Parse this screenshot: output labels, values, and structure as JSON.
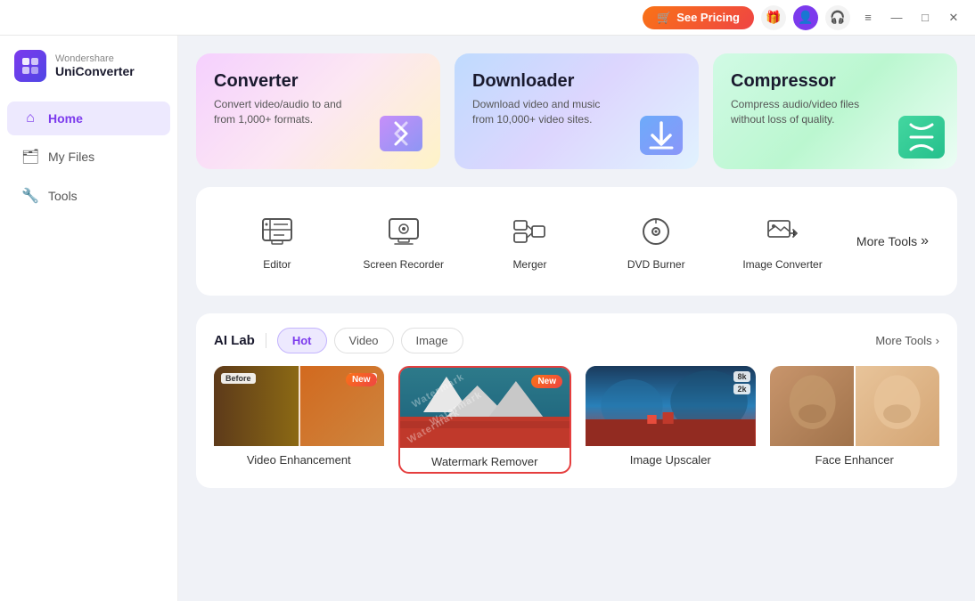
{
  "titlebar": {
    "see_pricing": "See Pricing",
    "cart_icon": "🛒",
    "gift_icon": "🎁",
    "user_icon": "👤",
    "headset_icon": "🎧",
    "menu_icon": "≡",
    "minimize": "—",
    "maximize": "□",
    "close": "✕"
  },
  "logo": {
    "brand": "Wondershare",
    "product": "UniConverter"
  },
  "sidebar": {
    "items": [
      {
        "id": "home",
        "label": "Home",
        "icon": "⌂",
        "active": true
      },
      {
        "id": "my-files",
        "label": "My Files",
        "icon": "🗂",
        "active": false
      },
      {
        "id": "tools",
        "label": "Tools",
        "icon": "🔧",
        "active": false
      }
    ]
  },
  "hero_cards": [
    {
      "id": "converter",
      "title": "Converter",
      "desc": "Convert video/audio to and from 1,000+ formats.",
      "type": "converter"
    },
    {
      "id": "downloader",
      "title": "Downloader",
      "desc": "Download video and music from 10,000+ video sites.",
      "type": "downloader"
    },
    {
      "id": "compressor",
      "title": "Compressor",
      "desc": "Compress audio/video files without loss of quality.",
      "type": "compressor"
    }
  ],
  "tools": {
    "items": [
      {
        "id": "editor",
        "label": "Editor"
      },
      {
        "id": "screen-recorder",
        "label": "Screen Recorder"
      },
      {
        "id": "merger",
        "label": "Merger"
      },
      {
        "id": "dvd-burner",
        "label": "DVD Burner"
      },
      {
        "id": "image-converter",
        "label": "Image Converter"
      }
    ],
    "more_label": "More Tools"
  },
  "ailab": {
    "label": "AI Lab",
    "tabs": [
      {
        "id": "hot",
        "label": "Hot",
        "active": true
      },
      {
        "id": "video",
        "label": "Video",
        "active": false
      },
      {
        "id": "image",
        "label": "Image",
        "active": false
      }
    ],
    "more_tools": "More Tools",
    "cards": [
      {
        "id": "video-enhancement",
        "label": "Video Enhancement",
        "new_badge": "New",
        "selected": false
      },
      {
        "id": "watermark-remover",
        "label": "Watermark Remover",
        "new_badge": "New",
        "selected": true
      },
      {
        "id": "image-upscaler",
        "label": "Image Upscaler",
        "new_badge": null,
        "selected": false
      },
      {
        "id": "face-enhancer",
        "label": "Face Enhancer",
        "new_badge": null,
        "selected": false
      }
    ]
  }
}
